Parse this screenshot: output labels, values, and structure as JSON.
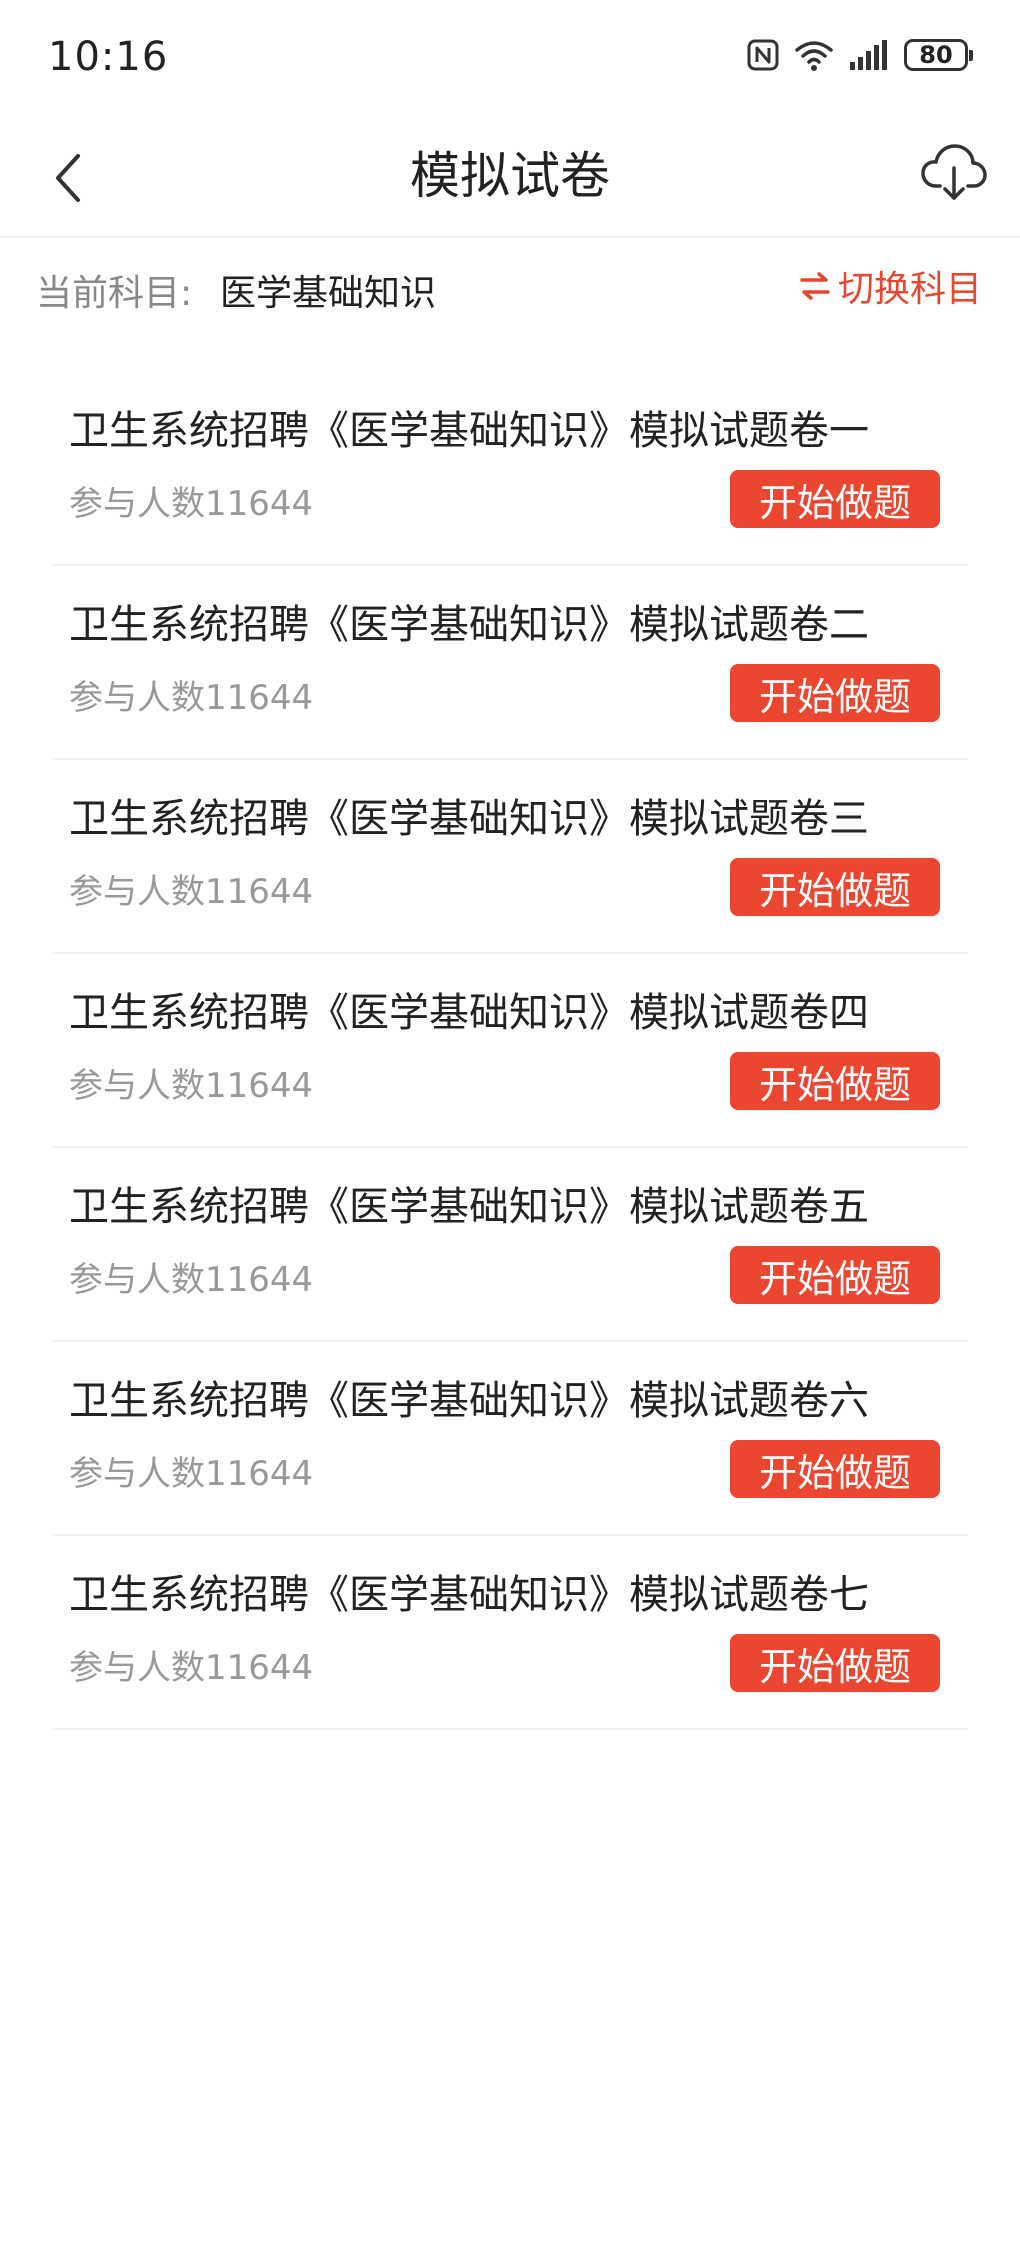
{
  "status_bar": {
    "time": "10:16",
    "battery": "80",
    "icons": [
      "nfc-icon",
      "wifi-icon",
      "signal-icon",
      "battery-icon"
    ]
  },
  "header": {
    "title": "模拟试卷",
    "back_icon": "chevron-left-icon",
    "download_icon": "cloud-download-icon"
  },
  "subject": {
    "label": "当前科目:",
    "value": "医学基础知识",
    "switch_label": "切换科目",
    "switch_icon": "swap-arrows-icon"
  },
  "colors": {
    "accent": "#ea4630",
    "text_primary": "#222222",
    "text_secondary": "#999999"
  },
  "papers": [
    {
      "title": "卫生系统招聘《医学基础知识》模拟试题卷一",
      "participants": "参与人数11644",
      "action": "开始做题"
    },
    {
      "title": "卫生系统招聘《医学基础知识》模拟试题卷二",
      "participants": "参与人数11644",
      "action": "开始做题"
    },
    {
      "title": "卫生系统招聘《医学基础知识》模拟试题卷三",
      "participants": "参与人数11644",
      "action": "开始做题"
    },
    {
      "title": "卫生系统招聘《医学基础知识》模拟试题卷四",
      "participants": "参与人数11644",
      "action": "开始做题"
    },
    {
      "title": "卫生系统招聘《医学基础知识》模拟试题卷五",
      "participants": "参与人数11644",
      "action": "开始做题"
    },
    {
      "title": "卫生系统招聘《医学基础知识》模拟试题卷六",
      "participants": "参与人数11644",
      "action": "开始做题"
    },
    {
      "title": "卫生系统招聘《医学基础知识》模拟试题卷七",
      "participants": "参与人数11644",
      "action": "开始做题"
    }
  ]
}
